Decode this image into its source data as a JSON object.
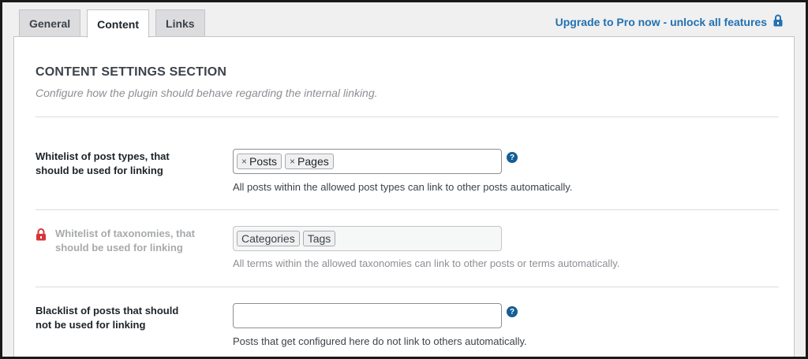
{
  "tabs": [
    {
      "label": "General"
    },
    {
      "label": "Content"
    },
    {
      "label": "Links"
    }
  ],
  "upgrade": {
    "label": "Upgrade to Pro now - unlock all features",
    "icon": "lock-icon"
  },
  "section": {
    "title": "CONTENT SETTINGS SECTION",
    "description": "Configure how the plugin should behave regarding the internal linking."
  },
  "rows": [
    {
      "label_line1": "Whitelist of post types, that",
      "label_line2": "should be used for linking",
      "chips": [
        "Posts",
        "Pages"
      ],
      "hint": "All posts within the allowed post types can link to other posts automatically.",
      "help": "?"
    },
    {
      "label_line1": "Whitelist of taxonomies, that",
      "label_line2": "should be used for linking",
      "chips": [
        "Categories",
        "Tags"
      ],
      "hint": "All terms within the allowed taxonomies can link to other posts or terms automatically."
    },
    {
      "label_line1": "Blacklist of posts that should",
      "label_line2": "not be used for linking",
      "chips": [],
      "hint": "Posts that get configured here do not link to others automatically.",
      "help": "?"
    }
  ],
  "colors": {
    "accent": "#2271b1",
    "help": "#135e96",
    "lock": "#d63638"
  }
}
